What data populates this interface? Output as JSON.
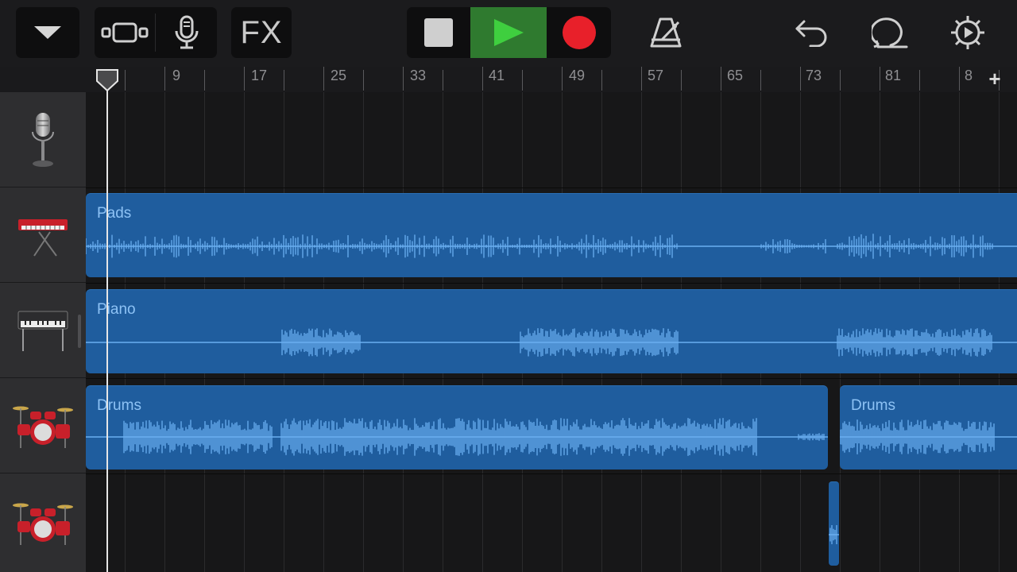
{
  "toolbar": {
    "buttons": [
      {
        "name": "tracks-menu-button",
        "icon": "chevron-down-icon"
      },
      {
        "name": "tracks-view-button",
        "icon": "tracks-view-icon"
      },
      {
        "name": "microphone-button",
        "icon": "microphone-icon"
      },
      {
        "name": "fx-button",
        "label": "FX"
      },
      {
        "name": "stop-button",
        "icon": "stop-icon"
      },
      {
        "name": "play-button",
        "icon": "play-icon"
      },
      {
        "name": "record-button",
        "icon": "record-icon"
      },
      {
        "name": "metronome-button",
        "icon": "metronome-icon"
      },
      {
        "name": "undo-button",
        "icon": "undo-icon"
      },
      {
        "name": "loop-browser-button",
        "icon": "loop-icon"
      },
      {
        "name": "settings-button",
        "icon": "gear-icon"
      }
    ],
    "fx_label": "FX",
    "colors": {
      "play_active": "#2f7a2f",
      "play_icon": "#3fcf3f",
      "record": "#e8202a"
    }
  },
  "ruler": {
    "bar_numbers": [
      "9",
      "17",
      "25",
      "33",
      "41",
      "49",
      "57",
      "65",
      "73",
      "81",
      "8"
    ],
    "add_track_label": "+"
  },
  "tracks": [
    {
      "instrument": "microphone-icon",
      "regions": []
    },
    {
      "instrument": "keyboard-synth-icon",
      "regions": [
        {
          "name": "Pads"
        }
      ]
    },
    {
      "instrument": "electric-piano-icon",
      "regions": [
        {
          "name": "Piano"
        }
      ]
    },
    {
      "instrument": "drum-kit-icon",
      "regions": [
        {
          "name": "Drums"
        },
        {
          "name": "Drums"
        }
      ]
    },
    {
      "instrument": "drum-kit-icon",
      "regions": [
        {
          "name": ""
        }
      ]
    }
  ],
  "colors": {
    "region": "#1f5d9e",
    "region_text": "#8dc2f5",
    "waveform": "#6aaef0"
  }
}
